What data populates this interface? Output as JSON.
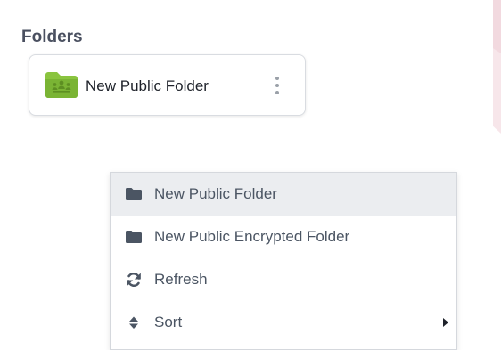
{
  "section": {
    "title": "Folders"
  },
  "folders": [
    {
      "name": "New Public Folder",
      "icon": "public-folder-icon",
      "icon_color": "#8ac43f"
    }
  ],
  "context_menu": {
    "items": [
      {
        "label": "New Public Folder",
        "icon": "folder-icon",
        "highlighted": true,
        "has_submenu": false
      },
      {
        "label": "New Public Encrypted Folder",
        "icon": "folder-icon",
        "highlighted": false,
        "has_submenu": false
      },
      {
        "label": "Refresh",
        "icon": "refresh-icon",
        "highlighted": false,
        "has_submenu": false
      },
      {
        "label": "Sort",
        "icon": "sort-icon",
        "highlighted": false,
        "has_submenu": true
      }
    ]
  },
  "colors": {
    "accent_green": "#8ac43f",
    "menu_highlight": "#ebedf0",
    "menu_icon": "#4b5563",
    "background_pattern": "#f7e6ea"
  }
}
